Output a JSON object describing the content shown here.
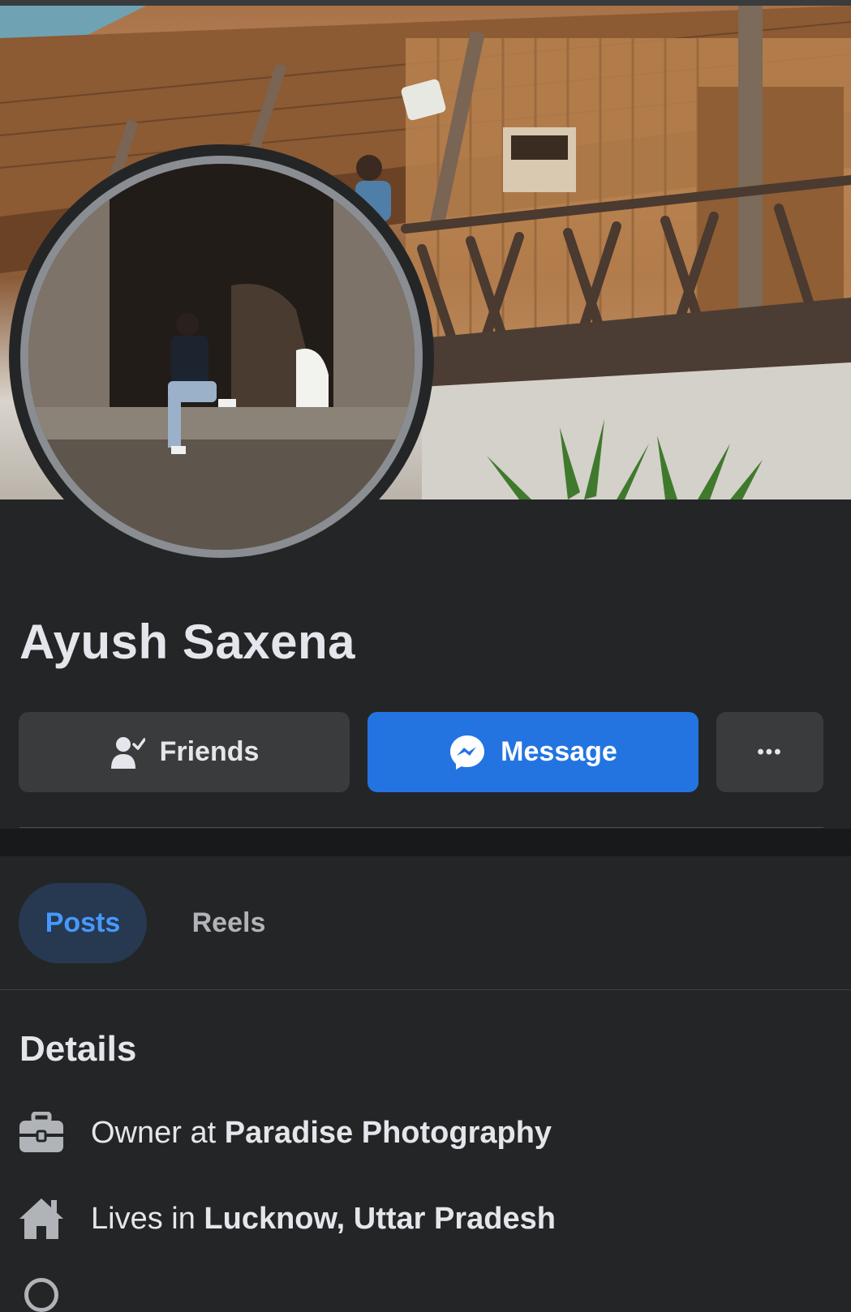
{
  "profile": {
    "name": "Ayush Saxena"
  },
  "actions": {
    "friends_label": "Friends",
    "message_label": "Message",
    "more_label": "•••"
  },
  "tabs": [
    {
      "label": "Posts",
      "active": true
    },
    {
      "label": "Reels",
      "active": false
    }
  ],
  "details": {
    "title": "Details",
    "work": {
      "prefix": "Owner at ",
      "value": "Paradise Photography",
      "icon": "briefcase-icon"
    },
    "home": {
      "prefix": "Lives in ",
      "value": "Lucknow, Uttar Pradesh",
      "icon": "house-icon"
    }
  },
  "colors": {
    "background": "#242526",
    "accent": "#2374e1",
    "active_tab_bg": "#263951",
    "active_tab_text": "#4599ff"
  }
}
